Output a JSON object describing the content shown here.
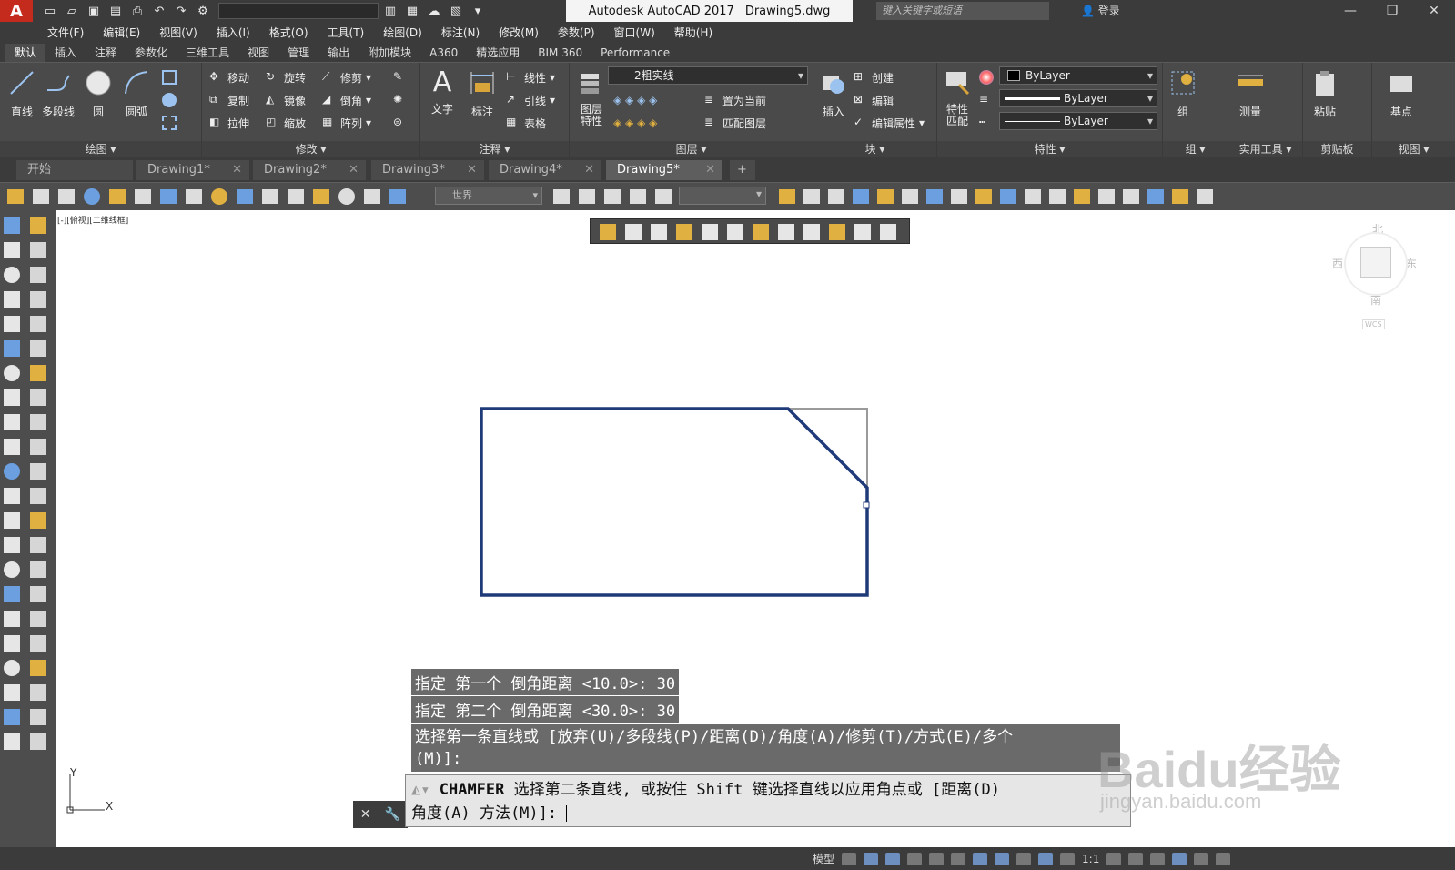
{
  "title_bar": {
    "app_name": "Autodesk AutoCAD 2017",
    "document": "Drawing5.dwg",
    "search_placeholder": "键入关键字或短语",
    "login_label": "登录"
  },
  "menubar": [
    "文件(F)",
    "编辑(E)",
    "视图(V)",
    "插入(I)",
    "格式(O)",
    "工具(T)",
    "绘图(D)",
    "标注(N)",
    "修改(M)",
    "参数(P)",
    "窗口(W)",
    "帮助(H)"
  ],
  "ribbon_tabs": [
    "默认",
    "插入",
    "注释",
    "参数化",
    "三维工具",
    "视图",
    "管理",
    "输出",
    "附加模块",
    "A360",
    "精选应用",
    "BIM 360",
    "Performance"
  ],
  "ribbon": {
    "draw": {
      "title": "绘图",
      "tools": [
        "直线",
        "多段线",
        "圆",
        "圆弧"
      ]
    },
    "modify": {
      "title": "修改",
      "tools": [
        "移动",
        "旋转",
        "修剪",
        "复制",
        "镜像",
        "倒角",
        "拉伸",
        "缩放",
        "阵列"
      ]
    },
    "annotation": {
      "title": "注释",
      "tools": [
        "文字",
        "标注",
        "线性",
        "引线",
        "表格"
      ]
    },
    "layers": {
      "title": "图层",
      "layer_props": "图层\n特性",
      "current_layer": "2粗实线",
      "tools": [
        "置为当前",
        "匹配图层"
      ]
    },
    "block": {
      "title": "块",
      "tools": [
        "插入",
        "创建",
        "编辑",
        "编辑属性"
      ]
    },
    "properties": {
      "title": "特性",
      "match": "特性\n匹配",
      "color": "ByLayer",
      "linetype": "ByLayer",
      "lineweight": "ByLayer"
    },
    "groups": {
      "title": "组",
      "tool": "组"
    },
    "utilities": {
      "title": "实用工具",
      "tool": "测量"
    },
    "clipboard": {
      "title": "剪贴板",
      "tool": "粘贴"
    },
    "view": {
      "title": "视图",
      "tool": "基点"
    }
  },
  "doc_tabs": [
    "开始",
    "Drawing1*",
    "Drawing2*",
    "Drawing3*",
    "Drawing4*",
    "Drawing5*"
  ],
  "toolbar2": {
    "ucs_combo": "世界"
  },
  "viewport_label": "[-][俯视][二维线框]",
  "viewcube": {
    "north": "北",
    "south": "南",
    "east": "东",
    "west": "西",
    "wcs": "WCS"
  },
  "command_history": [
    "指定 第一个 倒角距离 <10.0>: 30",
    "指定 第二个 倒角距离 <30.0>: 30",
    "选择第一条直线或 [放弃(U)/多段线(P)/距离(D)/角度(A)/修剪(T)/方式(E)/多个",
    "(M)]:"
  ],
  "command_prompt": {
    "command": "CHAMFER",
    "line1": "选择第二条直线, 或按住 Shift 键选择直线以应用角点或 [距离(D)",
    "line2": "角度(A) 方法(M)]: "
  },
  "ucs": {
    "x": "X",
    "y": "Y"
  },
  "statusbar": {
    "model": "模型",
    "scale": "1:1"
  },
  "watermark": {
    "text": "Baidu经验",
    "url": "jingyan.baidu.com"
  }
}
